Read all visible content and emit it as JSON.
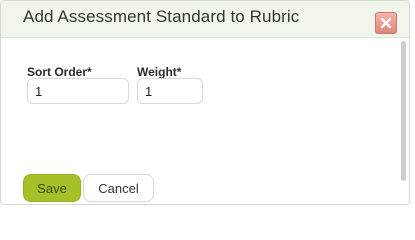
{
  "dialog": {
    "title": "Add Assessment Standard to Rubric",
    "close_icon": "close-icon"
  },
  "form": {
    "sort_order": {
      "label": "Sort Order*",
      "value": "1"
    },
    "weight": {
      "label": "Weight*",
      "value": "1"
    }
  },
  "actions": {
    "save_label": "Save",
    "cancel_label": "Cancel"
  },
  "colors": {
    "accent": "#a6c02a",
    "titlebar_bg": "#f1f6ec",
    "close_bg": "#e0867a"
  }
}
